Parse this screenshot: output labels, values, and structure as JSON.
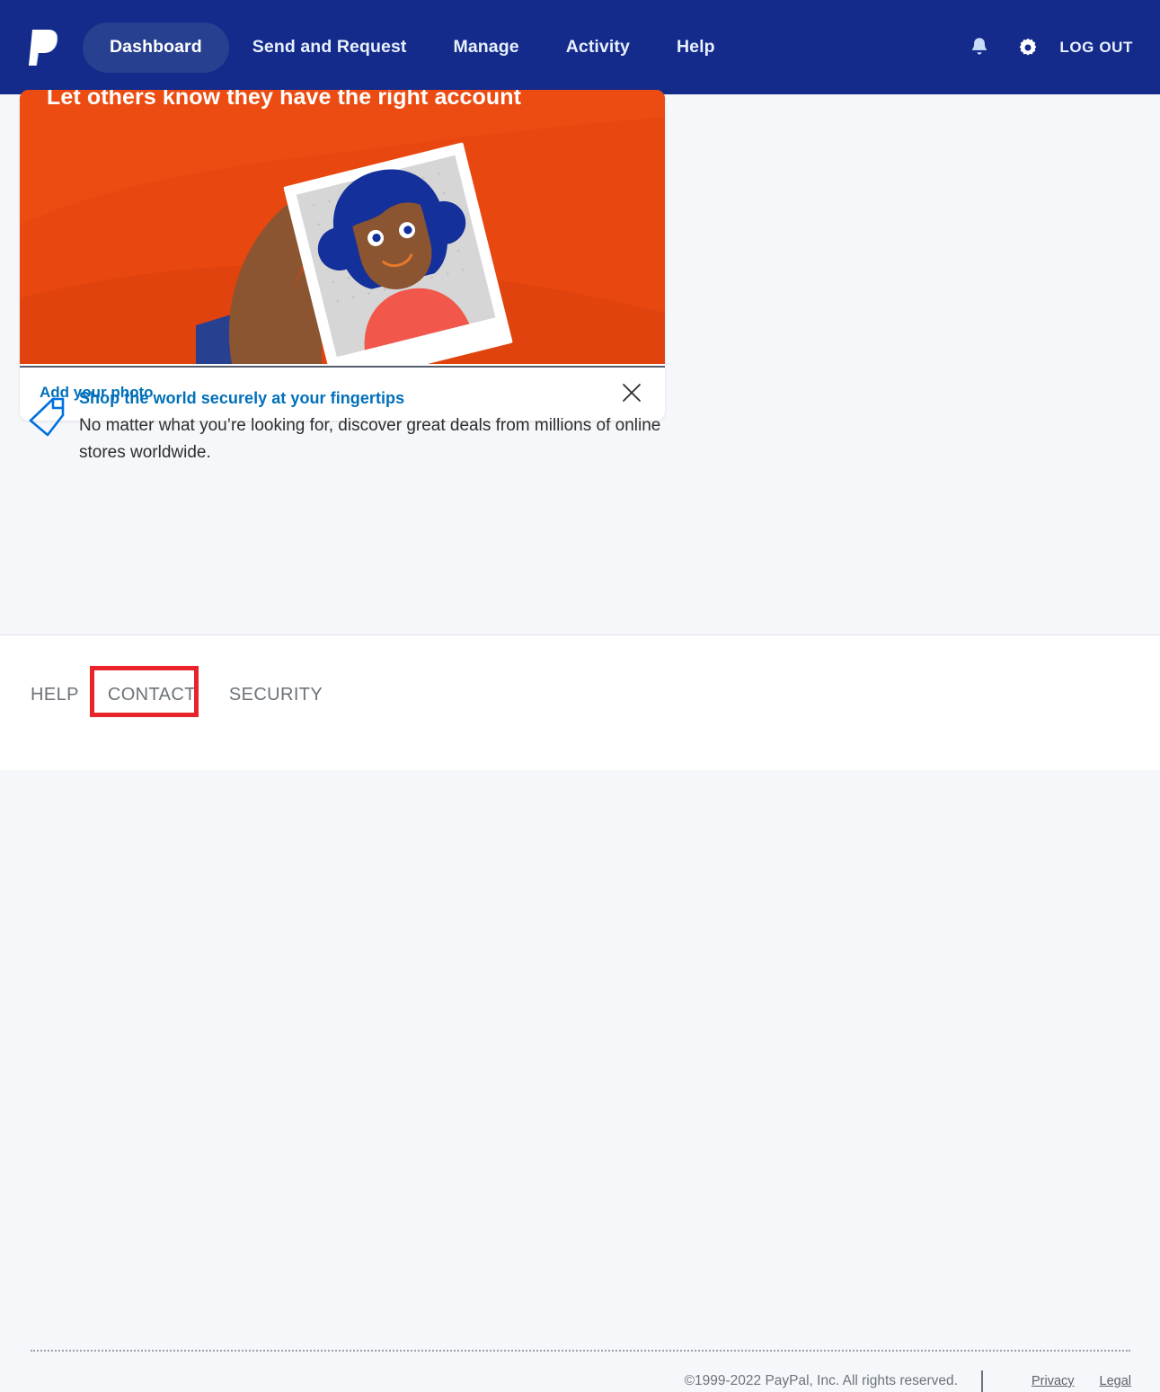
{
  "nav": {
    "logo_alt": "PayPal",
    "items": [
      {
        "label": "Dashboard",
        "active": true
      },
      {
        "label": "Send and Request",
        "active": false
      },
      {
        "label": "Manage",
        "active": false
      },
      {
        "label": "Activity",
        "active": false
      },
      {
        "label": "Help",
        "active": false
      }
    ],
    "notifications_icon": "bell-icon",
    "settings_icon": "gear-icon",
    "logout_label": "LOG OUT",
    "background_color": "#142b8c",
    "active_pill_color": "#27408f"
  },
  "promo": {
    "headline": "Let others know they have the right account",
    "link_label": "Add your photo",
    "close_icon": "close-icon",
    "banner_color": "#e8470f"
  },
  "tip": {
    "icon": "price-tag-icon",
    "title": "Shop the world securely at your fingertips",
    "text": "No matter what you’re looking for, discover great deals from millions of online stores worldwide.",
    "title_color": "#0070ba"
  },
  "footer": {
    "links": [
      {
        "label": "HELP",
        "highlighted": false
      },
      {
        "label": "CONTACT",
        "highlighted": true
      },
      {
        "label": "SECURITY",
        "highlighted": false
      }
    ],
    "highlight_color": "#e8232a",
    "copyright": "©1999-2022 PayPal, Inc. All rights reserved.",
    "legal_links": [
      {
        "label": "Privacy"
      },
      {
        "label": "Legal"
      }
    ]
  }
}
